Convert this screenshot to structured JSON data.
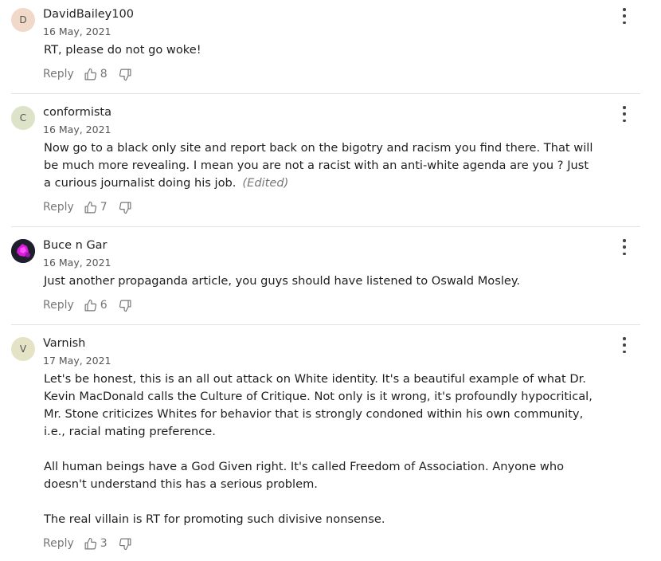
{
  "comments": [
    {
      "avatar_letter": "D",
      "avatar_color": "#f0d9c8",
      "author": "DavidBailey100",
      "date": "16 May, 2021",
      "paragraphs": [
        "RT, please do not go woke!"
      ],
      "edited": "",
      "reply_label": "Reply",
      "likes": "8"
    },
    {
      "avatar_letter": "C",
      "avatar_color": "#dde3c8",
      "author": "conformista",
      "date": "16 May, 2021",
      "paragraphs": [
        "Now go to a black only site and report back on the bigotry and racism you find there. That will be much more revealing.  I mean you are not a racist with an anti-white agenda are you ?  Just a curious journalist doing his job."
      ],
      "edited": "(Edited)",
      "reply_label": "Reply",
      "likes": "7"
    },
    {
      "avatar_letter": "",
      "avatar_color": "#2a2a3a",
      "author": "Buce n Gar",
      "date": "16 May, 2021",
      "paragraphs": [
        "Just another propaganda article, you guys should have listened to Oswald Mosley."
      ],
      "edited": "",
      "reply_label": "Reply",
      "likes": "6"
    },
    {
      "avatar_letter": "V",
      "avatar_color": "#e4e3c6",
      "author": "Varnish",
      "date": "17 May, 2021",
      "paragraphs": [
        "Let's be honest, this is an all out attack on White identity. It's a beautiful example of what Dr. Kevin MacDonald calls the Culture of Critique. Not only is it wrong, it's profoundly hypocritical, Mr. Stone criticizes Whites for behavior that is strongly condoned within his own community, i.e., racial mating preference.",
        "All human beings have a God Given right. It's called Freedom of Association. Anyone who doesn't understand this has a serious problem.",
        "The real villain is RT for promoting such divisive nonsense."
      ],
      "edited": "",
      "reply_label": "Reply",
      "likes": "3"
    }
  ]
}
